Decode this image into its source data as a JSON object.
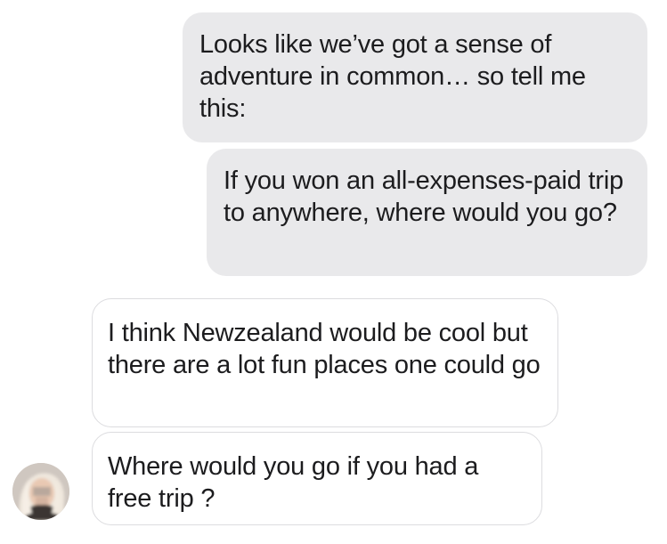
{
  "conversation": {
    "messages": [
      {
        "sender": "me",
        "text": "Looks like we’ve got a sense of adventure in common… so tell me this:"
      },
      {
        "sender": "me",
        "text": "If you won an all-expenses-paid trip to anywhere, where would you go?"
      },
      {
        "sender": "them",
        "text": "I think Newzealand  would be cool but there are a lot fun places one could go"
      },
      {
        "sender": "them",
        "text": "Where would you go if you had a free trip ?"
      }
    ]
  },
  "colors": {
    "sent_bubble": "#e9e9eb",
    "received_bubble": "#ffffff",
    "received_border": "#dcdcdf",
    "text": "#1c1c1e"
  },
  "icons": {
    "avatar": "contact-avatar"
  }
}
